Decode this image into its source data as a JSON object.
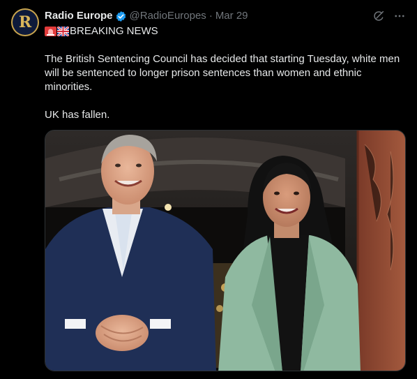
{
  "account": {
    "avatar_letter": "R",
    "display_name": "Radio Europe",
    "handle": "@RadioEuropes",
    "separator": "·",
    "date": "Mar 29"
  },
  "post": {
    "headline": "BREAKING NEWS",
    "paragraphs": [
      "The British Sentencing Council has decided that starting Tuesday, white men will be sentenced to longer prison sentences than women and ethnic minorities.",
      "UK has fallen."
    ]
  },
  "icons": {
    "verified": "verified-badge-icon",
    "grok": "grok-icon",
    "more": "more-options-icon",
    "siren": "siren-emoji",
    "flag": "uk-flag-emoji"
  },
  "colors": {
    "background": "#000000",
    "text": "#e7e9ea",
    "muted": "#71767b",
    "verified": "#1d9bf0"
  }
}
